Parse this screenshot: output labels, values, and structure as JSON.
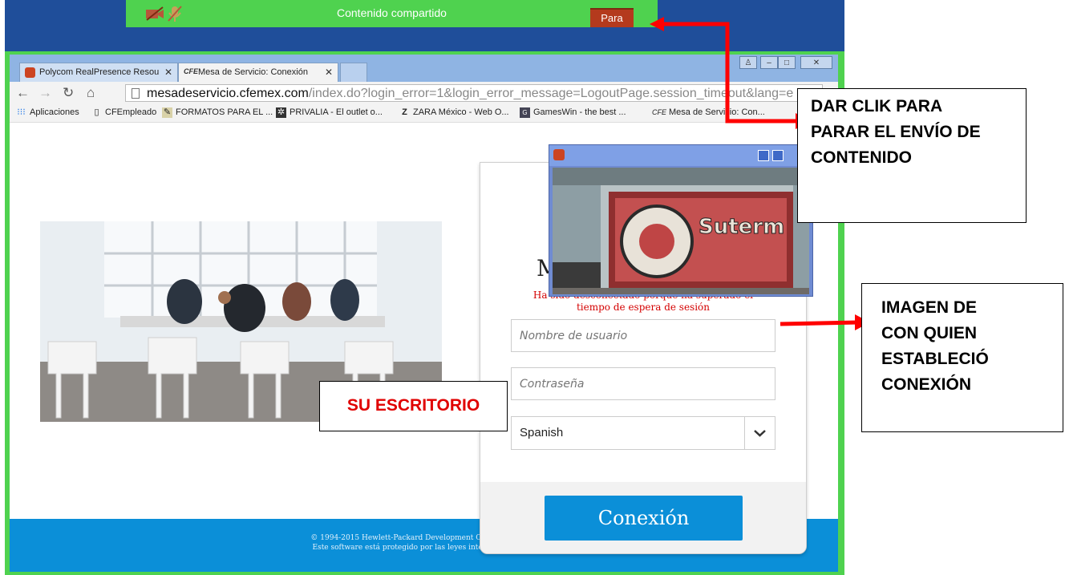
{
  "share_bar": {
    "title": "Contenido compartido",
    "stop_label": "Para"
  },
  "browser": {
    "tabs": [
      {
        "label": "Polycom RealPresence Resou",
        "active": false
      },
      {
        "label": "Mesa de Servicio: Conexión",
        "active": true
      }
    ],
    "url_domain": "mesadeservicio.cfemex.com",
    "url_path": "/index.do?login_error=1&login_error_message=LogoutPage.session_timeout&lang=e",
    "bookmarks": [
      {
        "label": "Aplicaciones",
        "icon": "apps-grid-icon"
      },
      {
        "label": "CFEmpleado",
        "icon": "page-icon"
      },
      {
        "label": "FORMATOS PARA EL ...",
        "icon": "image-icon"
      },
      {
        "label": "PRIVALIA - El outlet o...",
        "icon": "privalia-icon"
      },
      {
        "label": "ZARA México - Web O...",
        "icon": "zara-icon"
      },
      {
        "label": "GamesWin - the best ...",
        "icon": "gameswin-icon"
      },
      {
        "label": "Mesa de Servicio: Con...",
        "icon": "cfe-icon"
      }
    ]
  },
  "login": {
    "title": "M",
    "error_line1": "Ha sido desconectado porque ha superado el",
    "error_line2": "tiempo de espera de sesión",
    "username_placeholder": "Nombre de usuario",
    "password_placeholder": "Contraseña",
    "language": "Spanish",
    "submit_label": "Conexión"
  },
  "footer": {
    "line1": "© 1994-2015 Hewlett-Packard Development Company, L.P.",
    "line2": "Este software está protegido por las leyes internacionales"
  },
  "callouts": {
    "stop_sharing": [
      "DAR CLIK PARA",
      "PARAR EL ENVÍO DE",
      "CONTENIDO"
    ],
    "remote_image": [
      "IMAGEN DE",
      "CON QUIEN",
      "ESTABLECIÓ",
      "CONEXIÓN"
    ],
    "desktop": "SU ESCRITORIO"
  },
  "colors": {
    "share_bar": "#4fd24f",
    "stop_button": "#b43a1d",
    "callout_text_red": "#e00000",
    "arrow": "#ff0000",
    "login_button": "#0b8fd8"
  }
}
